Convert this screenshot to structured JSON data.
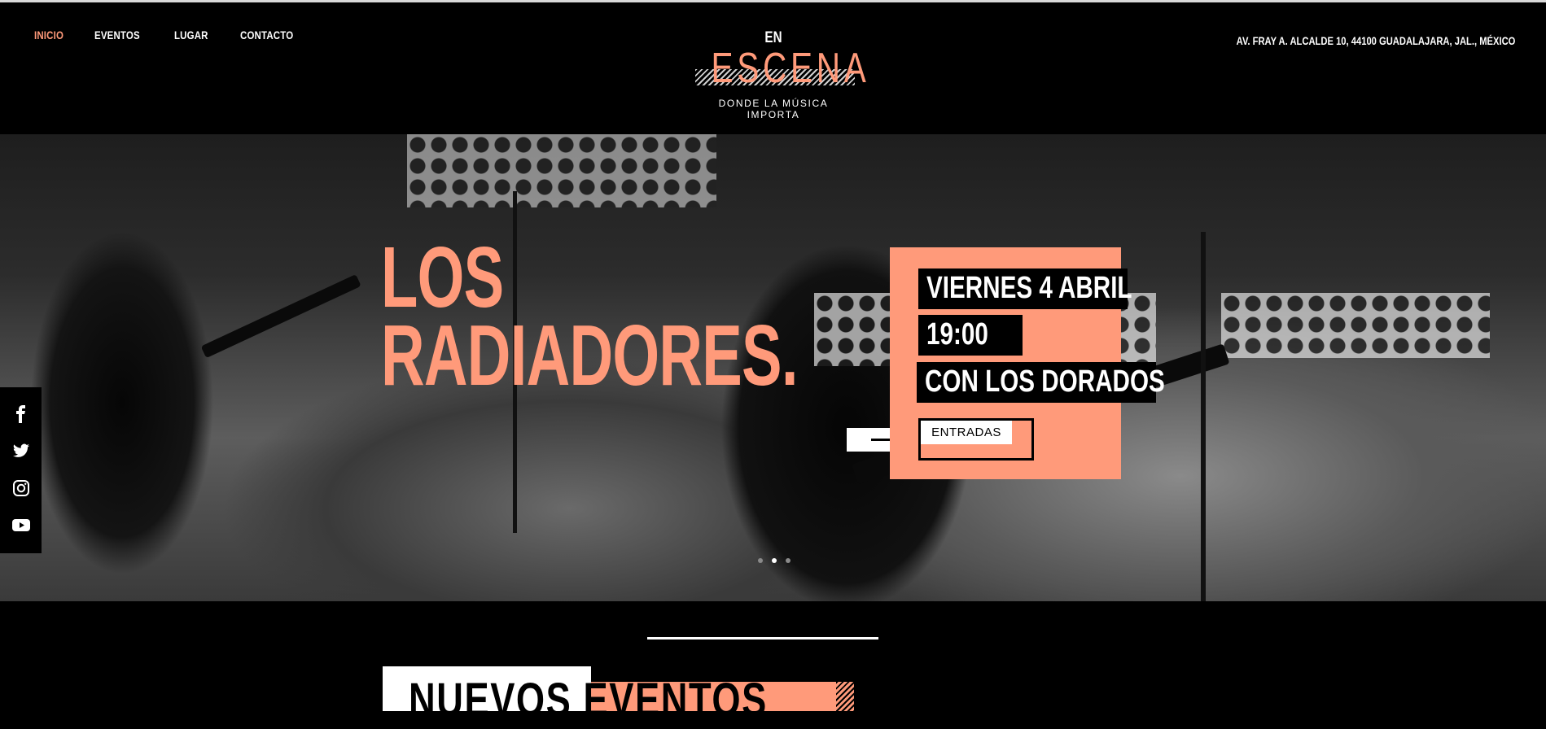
{
  "colors": {
    "accent": "#ff9a7a",
    "background": "#000000",
    "text": "#ffffff"
  },
  "header": {
    "nav": [
      "INICIO",
      "EVENTOS",
      "LUGAR",
      "CONTACTO"
    ],
    "active_index": 0,
    "address": "AV. FRAY A. ALCALDE 10, 44100 GUADALAJARA, JAL., MÉXICO",
    "logo": {
      "top": "EN",
      "main": "ESCENA",
      "tagline": "DONDE LA MÚSICA IMPORTA"
    }
  },
  "hero": {
    "band_line1": "LOS",
    "band_line2": "RADIADORES.",
    "date": "VIERNES 4 ABRIL",
    "time": "19:00",
    "support": "CON LOS DORADOS",
    "cta": "ENTRADAS",
    "cta_icon": "arrow-right-icon",
    "slides": {
      "count": 3,
      "active": 1
    }
  },
  "social": [
    "facebook-icon",
    "twitter-icon",
    "instagram-icon",
    "youtube-icon"
  ],
  "section": {
    "title": "NUEVOS EVENTOS"
  }
}
